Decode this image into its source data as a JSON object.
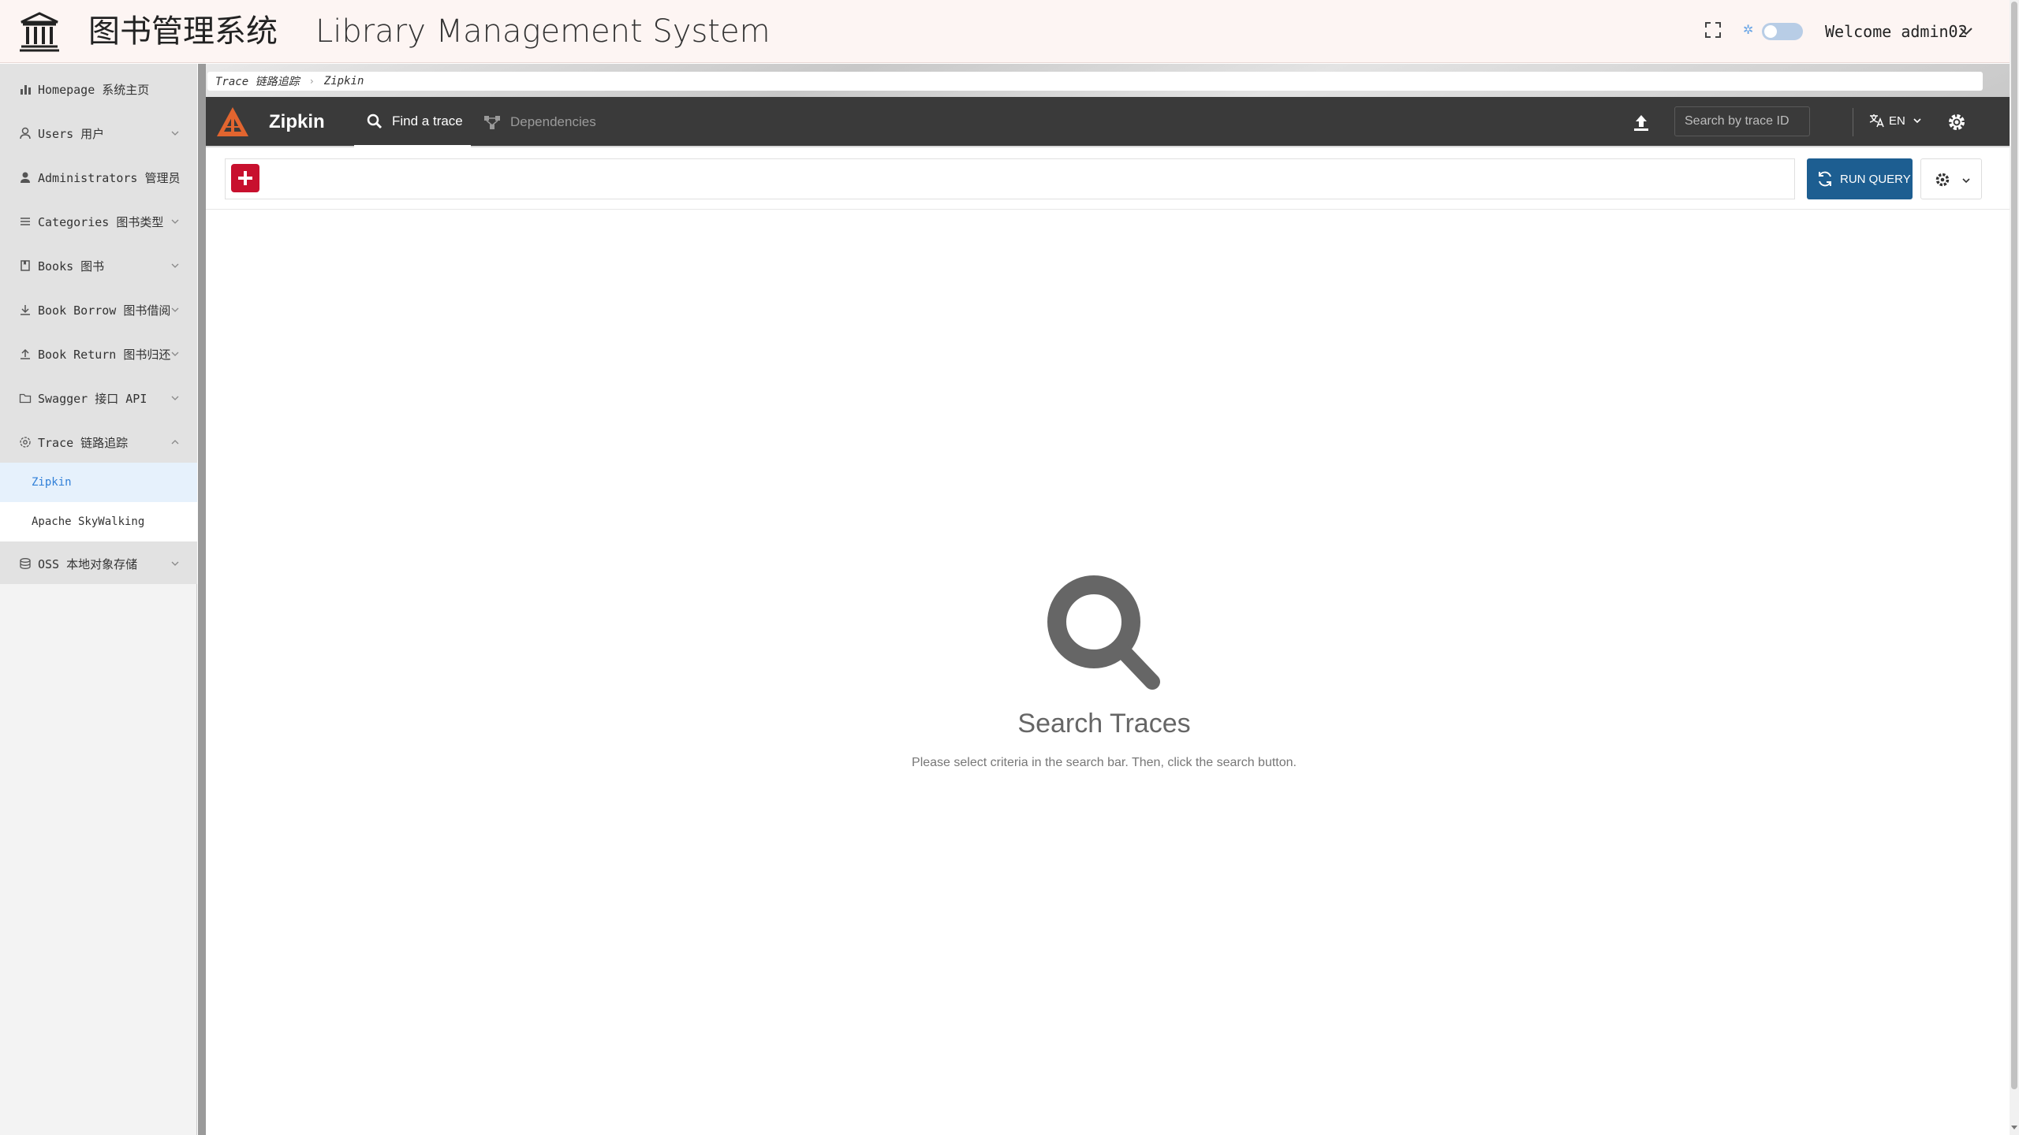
{
  "header": {
    "title_cn": "图书管理系统",
    "title_en": "Library Management System",
    "welcome": "Welcome admin02",
    "toggle_color": "#b8cde6"
  },
  "sidebar": {
    "items": [
      {
        "label": "Homepage 系统主页",
        "icon": "bar-chart-icon"
      },
      {
        "label": "Users 用户",
        "icon": "user-icon"
      },
      {
        "label": "Administrators 管理员",
        "icon": "admin-user-icon"
      },
      {
        "label": "Categories 图书类型",
        "icon": "list-icon"
      },
      {
        "label": "Books 图书",
        "icon": "book-icon"
      },
      {
        "label": "Book Borrow 图书借阅",
        "icon": "download-icon"
      },
      {
        "label": "Book Return 图书归还",
        "icon": "upload-icon"
      },
      {
        "label": "Swagger 接口 API",
        "icon": "folder-icon"
      },
      {
        "label": "Trace 链路追踪",
        "icon": "settings-icon"
      },
      {
        "label": "OSS 本地对象存储",
        "icon": "database-icon"
      }
    ],
    "trace_children": [
      {
        "label": "Zipkin",
        "active": true
      },
      {
        "label": "Apache SkyWalking",
        "active": false
      }
    ],
    "active_color": "#2f7fd8"
  },
  "breadcrumb": {
    "items": [
      "Trace 链路追踪",
      "Zipkin"
    ]
  },
  "zipkin": {
    "brand": "Zipkin",
    "tabs": [
      "Find a trace",
      "Dependencies"
    ],
    "search_placeholder": "Search by trace ID",
    "language": "EN",
    "run_query": "RUN QUERY",
    "bar_color": "#3a3a3a",
    "run_color": "#1d5e91",
    "add_color": "#c8102e",
    "logo_color": "#e2652f"
  },
  "empty_state": {
    "title": "Search Traces",
    "subtitle": "Please select criteria in the search bar. Then, click the search button."
  }
}
